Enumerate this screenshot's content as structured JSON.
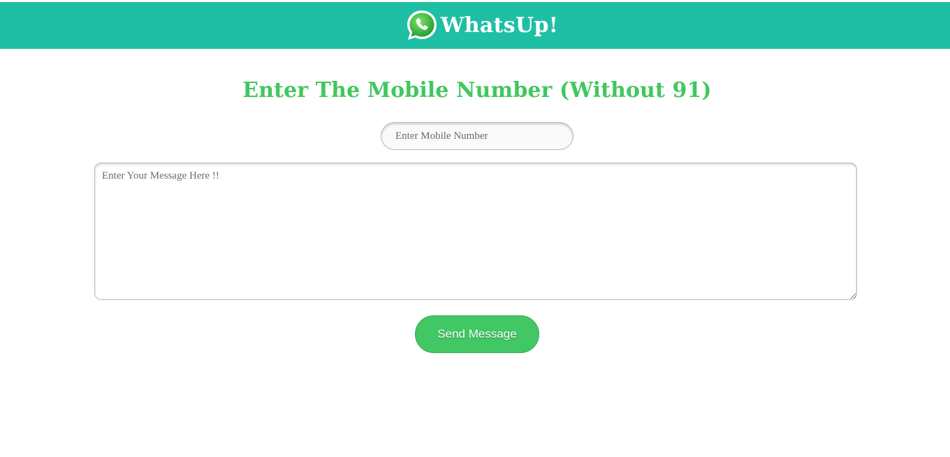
{
  "header": {
    "brand_name": "WhatsUp!",
    "logo_icon": "whatsapp-phone-icon",
    "background_color": "#1fbfa5"
  },
  "main": {
    "heading": "Enter The Mobile Number (Without 91)",
    "heading_color": "#41c75f",
    "mobile_input": {
      "placeholder": "Enter Mobile Number",
      "value": ""
    },
    "message_input": {
      "placeholder": "Enter Your Message Here !!",
      "value": ""
    },
    "send_button_label": "Send Message",
    "send_button_color": "#41c764"
  }
}
